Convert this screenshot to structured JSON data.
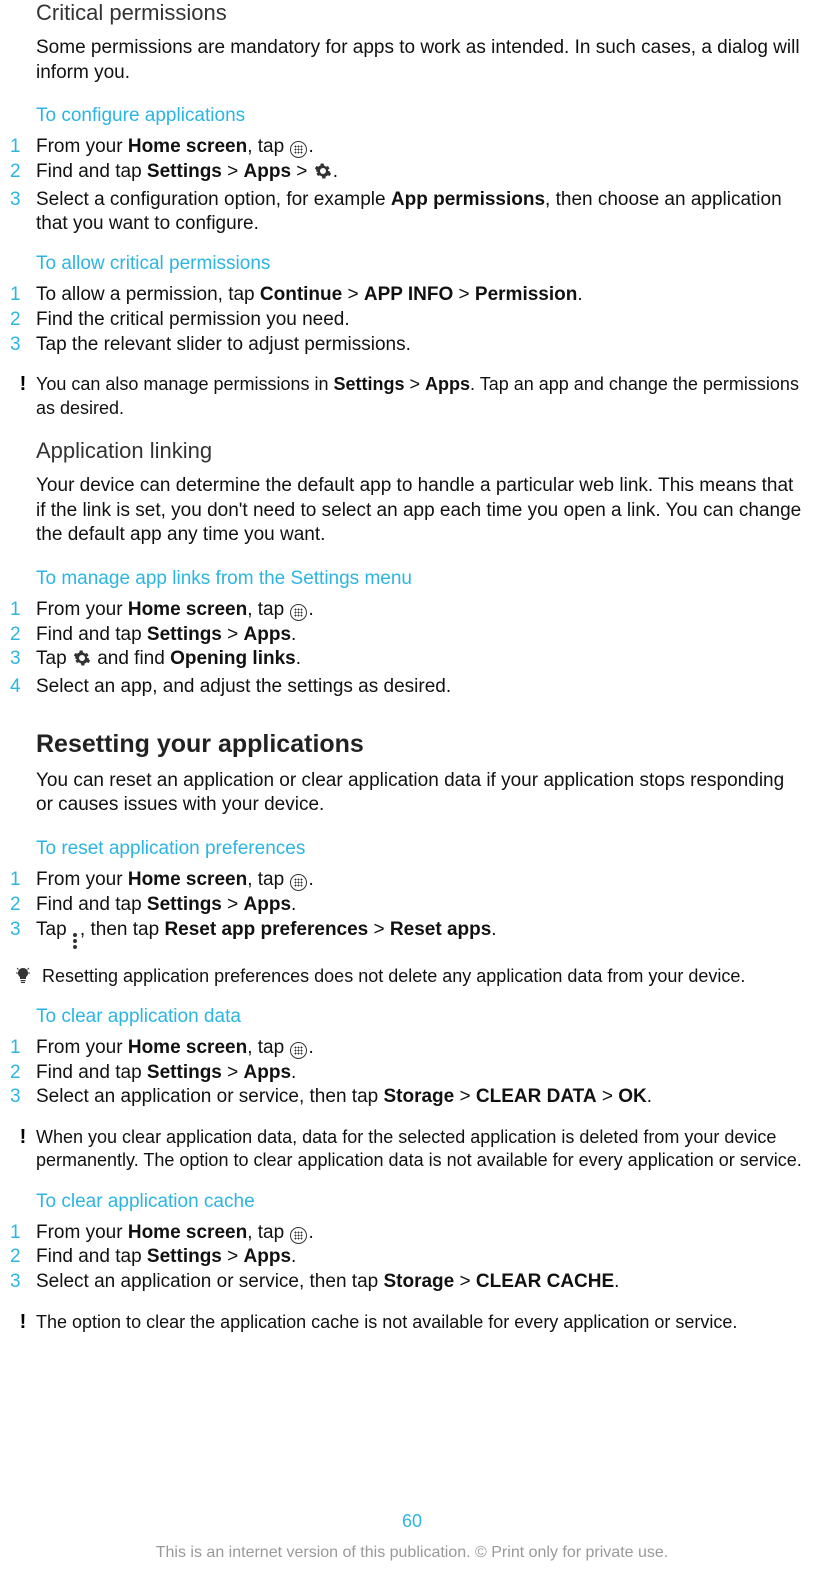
{
  "criticalPerms": {
    "title": "Critical permissions",
    "body": "Some permissions are mandatory for apps to work as intended. In such cases, a dialog will inform you."
  },
  "configApps": {
    "heading": "To configure applications",
    "s1a": "From your ",
    "s1b": "Home screen",
    "s1c": ", tap ",
    "s1d": ".",
    "s2a": "Find and tap ",
    "s2b": "Settings",
    "s2c": " > ",
    "s2d": "Apps",
    "s2e": " > ",
    "s2f": ".",
    "s3a": "Select a configuration option, for example ",
    "s3b": "App permissions",
    "s3c": ", then choose an application that you want to configure."
  },
  "allowCrit": {
    "heading": "To allow critical permissions",
    "s1a": "To allow a permission, tap ",
    "s1b": "Continue",
    "s1c": " > ",
    "s1d": "APP INFO",
    "s1e": " > ",
    "s1f": "Permission",
    "s1g": ".",
    "s2": "Find the critical permission you need.",
    "s3": "Tap the relevant slider to adjust permissions.",
    "note_a": "You can also manage permissions in ",
    "note_b": "Settings",
    "note_c": " > ",
    "note_d": "Apps",
    "note_e": ". Tap an app and change the permissions as desired."
  },
  "appLinking": {
    "title": "Application linking",
    "body": "Your device can determine the default app to handle a particular web link. This means that if the link is set, you don't need to select an app each time you open a link. You can change the default app any time you want."
  },
  "manageLinks": {
    "heading": "To manage app links from the Settings menu",
    "s1a": "From your ",
    "s1b": "Home screen",
    "s1c": ", tap ",
    "s1d": ".",
    "s2a": "Find and tap ",
    "s2b": "Settings",
    "s2c": " > ",
    "s2d": "Apps",
    "s2e": ".",
    "s3a": "Tap ",
    "s3b": " and find ",
    "s3c": "Opening links",
    "s3d": ".",
    "s4": "Select an app, and adjust the settings as desired."
  },
  "resetApps": {
    "title": "Resetting your applications",
    "body": "You can reset an application or clear application data if your application stops responding or causes issues with your device."
  },
  "resetPrefs": {
    "heading": "To reset application preferences",
    "s1a": "From your ",
    "s1b": "Home screen",
    "s1c": ", tap ",
    "s1d": ".",
    "s2a": "Find and tap ",
    "s2b": "Settings",
    "s2c": " > ",
    "s2d": "Apps",
    "s2e": ".",
    "s3a": "Tap ",
    "s3b": ", then tap ",
    "s3c": "Reset app preferences",
    "s3d": " > ",
    "s3e": "Reset apps",
    "s3f": ".",
    "tip": "Resetting application preferences does not delete any application data from your device."
  },
  "clearData": {
    "heading": "To clear application data",
    "s1a": "From your ",
    "s1b": "Home screen",
    "s1c": ", tap ",
    "s1d": ".",
    "s2a": "Find and tap ",
    "s2b": "Settings",
    "s2c": " > ",
    "s2d": "Apps",
    "s2e": ".",
    "s3a": "Select an application or service, then tap ",
    "s3b": "Storage",
    "s3c": " > ",
    "s3d": "CLEAR DATA",
    "s3e": " > ",
    "s3f": "OK",
    "s3g": ".",
    "note": "When you clear application data, data for the selected application is deleted from your device permanently. The option to clear application data is not available for every application or service."
  },
  "clearCache": {
    "heading": "To clear application cache",
    "s1a": "From your ",
    "s1b": "Home screen",
    "s1c": ", tap ",
    "s1d": ".",
    "s2a": "Find and tap ",
    "s2b": "Settings",
    "s2c": " > ",
    "s2d": "Apps",
    "s2e": ".",
    "s3a": "Select an application or service, then tap ",
    "s3b": "Storage",
    "s3c": " > ",
    "s3d": "CLEAR CACHE",
    "s3e": ".",
    "note": "The option to clear the application cache is not available for every application or service."
  },
  "nums": {
    "n1": "1",
    "n2": "2",
    "n3": "3",
    "n4": "4"
  },
  "footer": {
    "page": "60",
    "text": "This is an internet version of this publication. © Print only for private use."
  }
}
